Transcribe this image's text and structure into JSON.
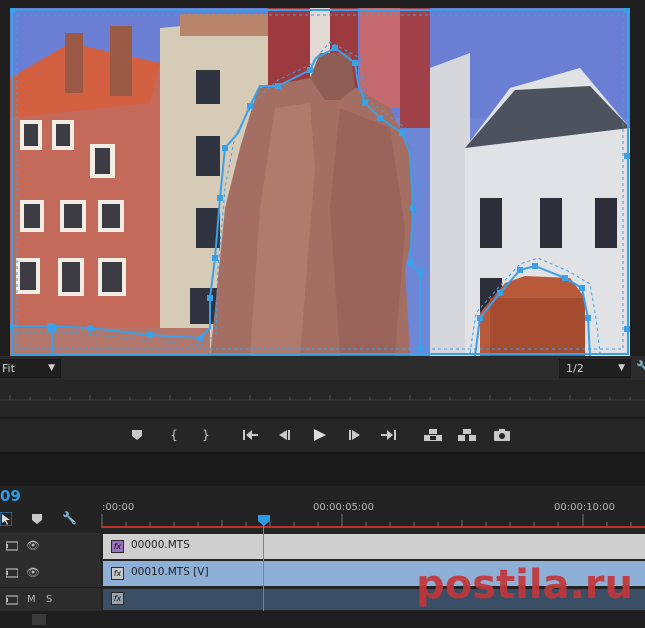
{
  "monitor": {
    "zoom_value": "Fit",
    "resolution_value": "1/2"
  },
  "transport": {
    "buttons": [
      "marker-icon",
      "mark-in-icon",
      "mark-out-icon",
      "go-to-in-icon",
      "step-back-icon",
      "play-icon",
      "step-forward-icon",
      "go-to-out-icon",
      "lift-icon",
      "extract-icon",
      "export-frame-icon"
    ]
  },
  "timeline": {
    "timecode": "09",
    "ruler_labels": [
      ":00:00",
      "00:00:05:00",
      "00:00:10:00"
    ],
    "tracks": [
      {
        "id": "v2",
        "clip_name": "00000.MTS",
        "clip_color": "#cfcfcf",
        "type": "video"
      },
      {
        "id": "v1",
        "clip_name": "00010.MTS [V]",
        "clip_color": "#8fb0d6",
        "type": "video"
      },
      {
        "id": "a1",
        "clip_name": "",
        "clip_color": "#3a4f66",
        "type": "audio",
        "m_label": "M",
        "s_label": "S"
      }
    ]
  },
  "watermark": "postila.ru",
  "colors": {
    "accent": "#2d9ae3",
    "playhead": "#2d9ae3",
    "ruler_red": "#c0312d",
    "mask": "#3aa0e8"
  }
}
